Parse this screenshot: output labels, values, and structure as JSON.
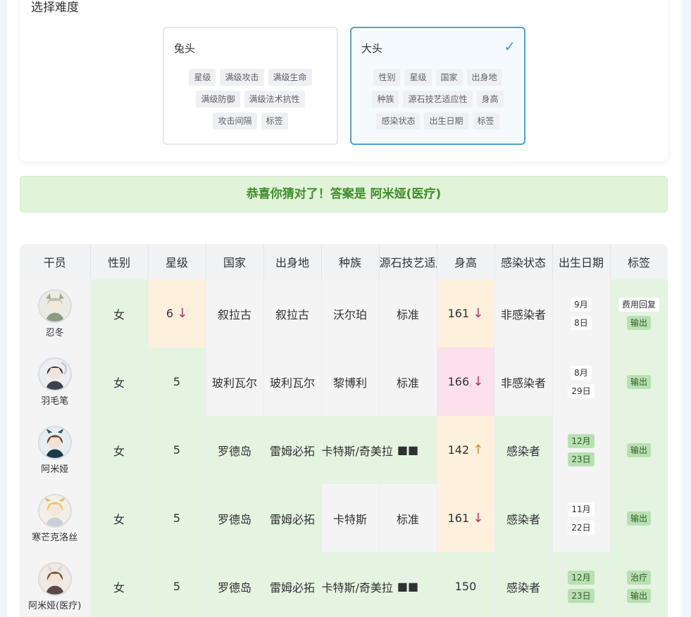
{
  "difficulty": {
    "title": "选择难度",
    "modes": [
      {
        "label": "兔头",
        "tags": [
          "星级",
          "满级攻击",
          "满级生命",
          "满级防御",
          "满级法术抗性",
          "攻击间隔",
          "标签"
        ]
      },
      {
        "label": "大头",
        "check": "✓",
        "tags": [
          "性别",
          "星级",
          "国家",
          "出身地",
          "种族",
          "源石技艺适应性",
          "身高",
          "感染状态",
          "出生日期",
          "标签"
        ]
      }
    ]
  },
  "result": {
    "message": "恭喜你猜对了！答案是 阿米娅(医疗)"
  },
  "colors": {
    "correct": "#e4f4e1",
    "close": "#fdf0dd",
    "wrong_high": "#fce0ec",
    "neutral": "#f4f4f5",
    "accent": "#4ea5cf"
  },
  "table": {
    "headers": [
      "干员",
      "性别",
      "星级",
      "国家",
      "出身地",
      "种族",
      "源石技艺适应性",
      "身高",
      "感染状态",
      "出生日期",
      "标签"
    ],
    "rows": [
      {
        "name": "忍冬",
        "gender": "女",
        "rarity": "6",
        "rarity_arrow": "↓",
        "nation": "叙拉古",
        "birthplace": "叙拉古",
        "race": "沃尔珀",
        "arts": "标准",
        "height": "161",
        "height_arrow": "↓",
        "infection": "非感染者",
        "birthday": [
          "9月",
          "8日"
        ],
        "tags": [
          "费用回复",
          "输出"
        ]
      },
      {
        "name": "羽毛笔",
        "gender": "女",
        "rarity": "5",
        "nation": "玻利瓦尔",
        "birthplace": "玻利瓦尔",
        "race": "黎博利",
        "arts": "标准",
        "height": "166",
        "height_arrow": "↓",
        "infection": "非感染者",
        "birthday": [
          "8月",
          "29日"
        ],
        "tags": [
          "输出"
        ]
      },
      {
        "name": "阿米娅",
        "gender": "女",
        "rarity": "5",
        "nation": "罗德岛",
        "birthplace": "雷姆必拓",
        "race": "卡特斯/奇美拉",
        "arts": "■■",
        "height": "142",
        "height_arrow": "↑",
        "infection": "感染者",
        "birthday": [
          "12月",
          "23日"
        ],
        "tags": [
          "输出"
        ]
      },
      {
        "name": "寒芒克洛丝",
        "gender": "女",
        "rarity": "5",
        "nation": "罗德岛",
        "birthplace": "雷姆必拓",
        "race": "卡特斯",
        "arts": "标准",
        "height": "161",
        "height_arrow": "↓",
        "infection": "感染者",
        "birthday": [
          "11月",
          "22日"
        ],
        "tags": [
          "输出"
        ]
      },
      {
        "name": "阿米娅(医疗)",
        "gender": "女",
        "rarity": "5",
        "nation": "罗德岛",
        "birthplace": "雷姆必拓",
        "race": "卡特斯/奇美拉",
        "arts": "■■",
        "height": "150",
        "infection": "感染者",
        "birthday": [
          "12月",
          "23日"
        ],
        "tags": [
          "治疗",
          "输出"
        ]
      }
    ]
  }
}
